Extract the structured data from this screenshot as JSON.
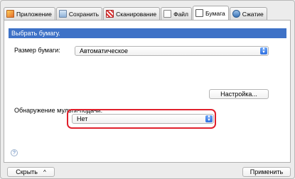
{
  "tabs": [
    {
      "label": "Приложение",
      "icon": "application-icon"
    },
    {
      "label": "Сохранить",
      "icon": "save-icon"
    },
    {
      "label": "Сканирование",
      "icon": "scan-icon"
    },
    {
      "label": "Файл",
      "icon": "file-icon"
    },
    {
      "label": "Бумага",
      "icon": "paper-icon",
      "active": true
    },
    {
      "label": "Сжатие",
      "icon": "compression-icon"
    }
  ],
  "panel": {
    "title": "Выбрать бумагу.",
    "paper_size_label": "Размер бумаги:",
    "paper_size_value": "Автоматическое",
    "settings_button": "Настройка...",
    "multifeed_label": "Обнаружение мульти-подачи:",
    "multifeed_value": "Нет",
    "help_symbol": "?"
  },
  "footer": {
    "hide_button": "Скрыть",
    "hide_chevron": "^",
    "apply_button": "Применить"
  },
  "colors": {
    "title_bar": "#3e72c7",
    "highlight": "#e0202c",
    "stepper": "#2f6fe0"
  }
}
